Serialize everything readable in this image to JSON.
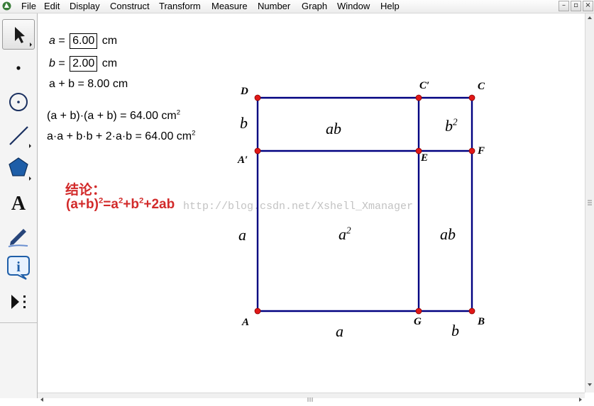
{
  "menu": [
    "File",
    "Edit",
    "Display",
    "Construct",
    "Transform",
    "Measure",
    "Number",
    "Graph",
    "Window",
    "Help"
  ],
  "window_controls": {
    "minimize": "–",
    "restore": "▫",
    "close": "×"
  },
  "tools": [
    {
      "name": "arrow-select-tool"
    },
    {
      "name": "point-tool"
    },
    {
      "name": "compass-tool"
    },
    {
      "name": "straightedge-tool"
    },
    {
      "name": "polygon-tool"
    },
    {
      "name": "text-tool",
      "glyph": "A"
    },
    {
      "name": "marker-tool"
    },
    {
      "name": "information-tool",
      "glyph": "i"
    },
    {
      "name": "custom-tool"
    }
  ],
  "measurements": {
    "a_var": "a",
    "a_eq": " = ",
    "a_value": "6.00",
    "a_unit": " cm",
    "b_var": "b",
    "b_eq": " = ",
    "b_value": "2.00",
    "b_unit": " cm",
    "sum_text": "a + b = 8.00 cm",
    "product_lhs": "(a + b)·(a + b) = 64.00 cm",
    "product_sup": "2",
    "expand_lhs": "a·a + b·b + 2·a·b = 64.00 cm",
    "expand_sup": "2"
  },
  "conclusion": {
    "heading": "结论：",
    "formula_a": "(a+b)",
    "sup1": "2",
    "formula_b": "=a",
    "sup2": "2",
    "formula_c": "+b",
    "sup3": "2",
    "formula_d": "+2ab"
  },
  "watermark": "http://blog.csdn.net/Xshell_Xmanager",
  "points": {
    "D": "D",
    "C_prime": "C′",
    "C": "C",
    "A_prime": "A′",
    "E": "E",
    "F": "F",
    "A": "A",
    "G": "G",
    "B": "B"
  },
  "region_labels": {
    "b_left": "b",
    "ab_top": "ab",
    "b_sq": "b",
    "b_sq_sup": "2",
    "a_left": "a",
    "a_sq": "a",
    "a_sq_sup": "2",
    "ab_right": "ab",
    "a_bottom": "a",
    "b_bottom": "b"
  },
  "colors": {
    "segment": "#000080",
    "point": "#e01818",
    "conclusion": "#d22a2a"
  }
}
